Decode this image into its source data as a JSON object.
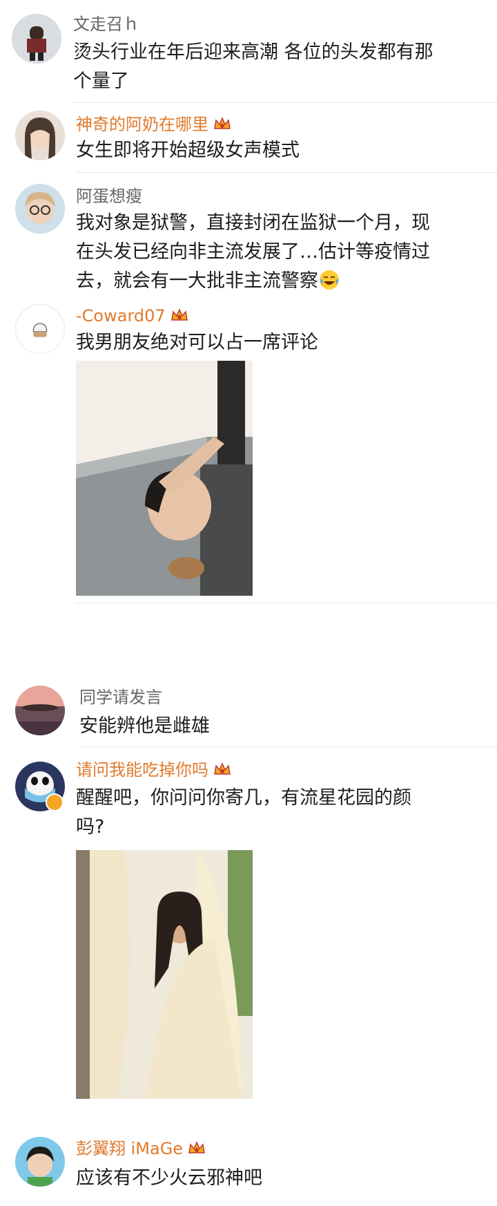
{
  "comments": [
    {
      "username": "文走召ｈ",
      "text": "烫头行业在年后迎来高潮 各位的头发都有那个量了"
    },
    {
      "username": "神奇的阿奶在哪里",
      "text": "女生即将开始超级女声模式"
    },
    {
      "username": "阿蛋想瘦",
      "text": "我对象是狱警，直接封闭在监狱一个月，现在头发已经向非主流发展了…估计等疫情过去，就会有一大批非主流警察"
    },
    {
      "username": "-Coward07",
      "text": "我男朋友绝对可以占一席评论"
    },
    {
      "username": "同学请发言",
      "text": "安能辨他是雌雄"
    },
    {
      "username": "请问我能吃掉你吗",
      "text": "醒醒吧，你问问你寄几，有流星花园的颜吗?"
    },
    {
      "username": "彭翼翔 iMaGe",
      "text": "应该有不少火云邪神吧"
    }
  ],
  "icons": {
    "vip": "crown-badge-icon",
    "verified": "verified-badge-icon",
    "emoji": "laughing-tears-emoji-icon"
  },
  "colors": {
    "vip_name": "#e07a2c",
    "normal_name": "#666666",
    "text": "#1d1d1d",
    "divider": "#e8e8e8"
  }
}
